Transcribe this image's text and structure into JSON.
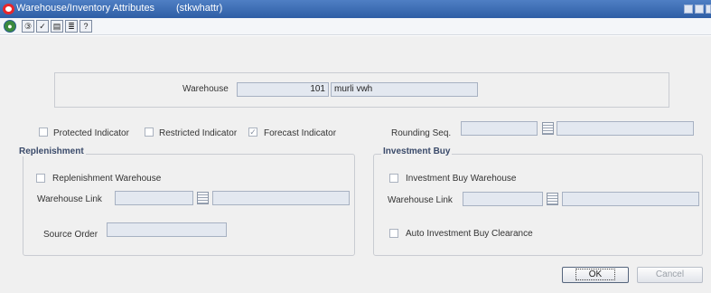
{
  "titlebar": {
    "title": "Warehouse/Inventory Attributes",
    "form_id": "(stkwhattr)"
  },
  "toolbar": {
    "icons": [
      "globe-icon",
      "info-icon",
      "spellcheck-icon",
      "print-icon",
      "notes-icon",
      "help-icon"
    ]
  },
  "warehouse": {
    "label": "Warehouse",
    "number": "101",
    "name": "murli vwh"
  },
  "indicators": {
    "protected_label": "Protected Indicator",
    "restricted_label": "Restricted Indicator",
    "forecast_label": "Forecast Indicator",
    "forecast_checked": true
  },
  "rounding": {
    "label": "Rounding Seq.",
    "value": "",
    "description": ""
  },
  "replenishment": {
    "title": "Replenishment",
    "repl_warehouse_label": "Replenishment Warehouse",
    "warehouse_link_label": "Warehouse Link",
    "warehouse_link_value": "",
    "warehouse_link_desc": "",
    "source_order_label": "Source Order",
    "source_order_value": ""
  },
  "investment_buy": {
    "title": "Investment Buy",
    "ib_warehouse_label": "Investment Buy Warehouse",
    "warehouse_link_label": "Warehouse Link",
    "warehouse_link_value": "",
    "warehouse_link_desc": "",
    "auto_clearance_label": "Auto Investment Buy Clearance"
  },
  "buttons": {
    "ok": "OK",
    "cancel": "Cancel"
  }
}
